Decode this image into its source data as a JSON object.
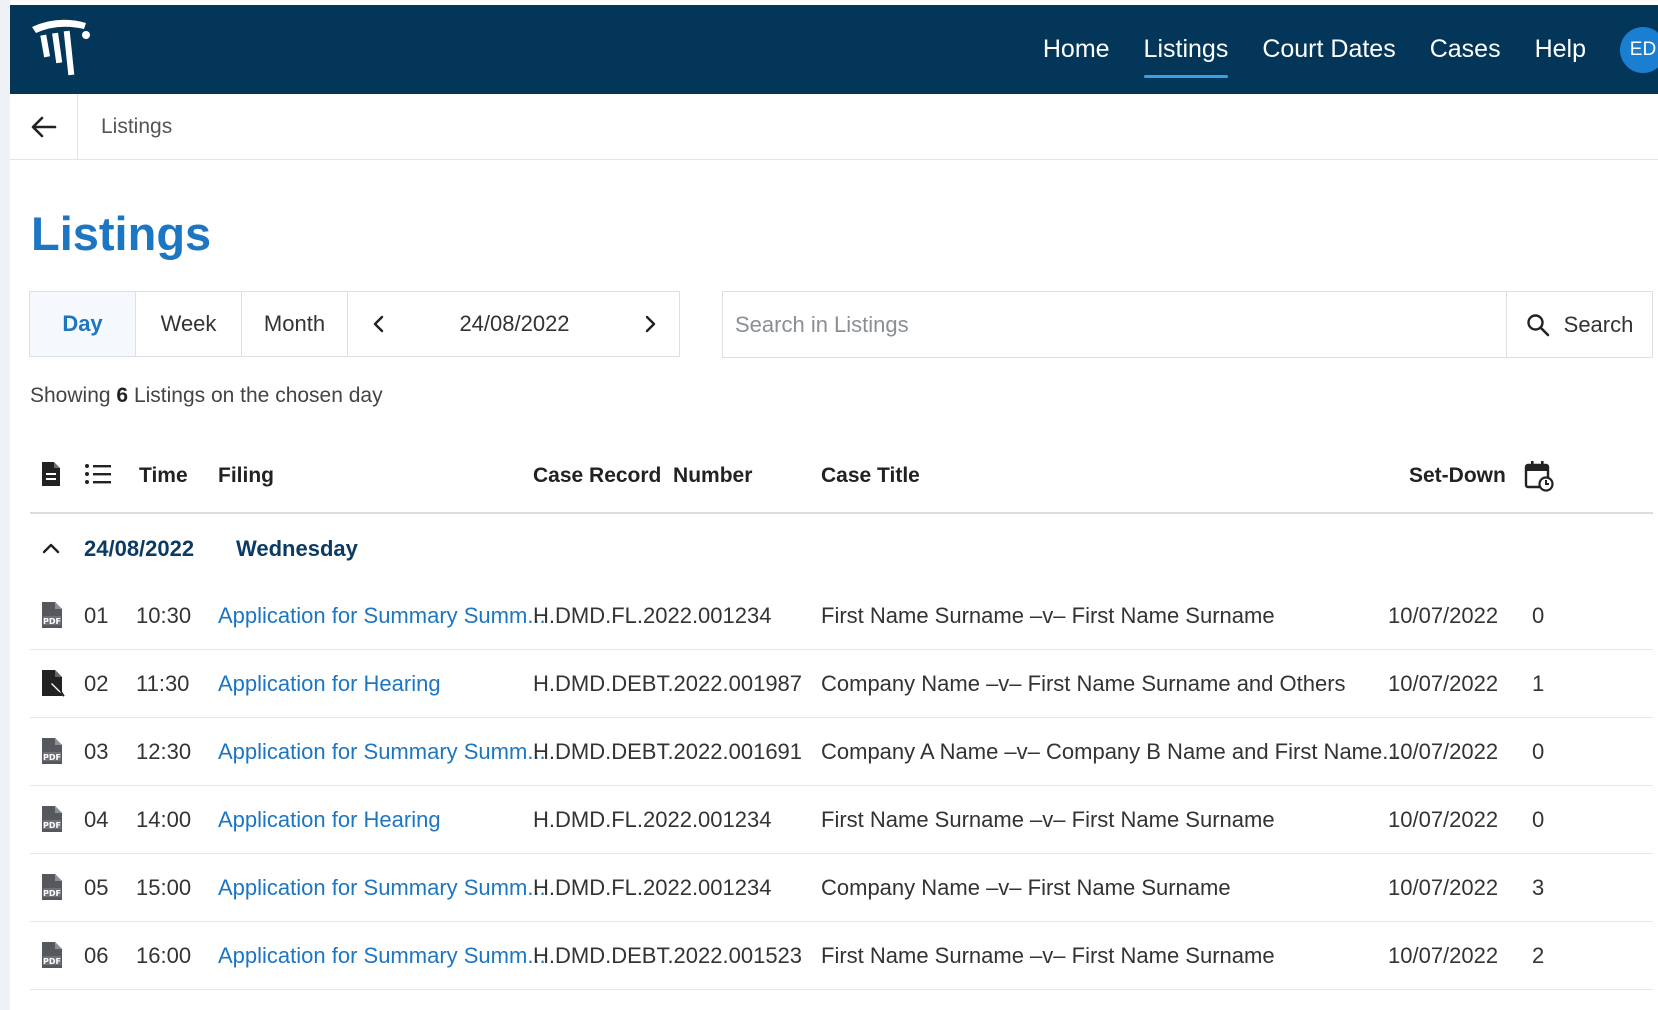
{
  "nav": {
    "items": [
      {
        "label": "Home",
        "active": false
      },
      {
        "label": "Listings",
        "active": true
      },
      {
        "label": "Court Dates",
        "active": false
      },
      {
        "label": "Cases",
        "active": false
      },
      {
        "label": "Help",
        "active": false
      }
    ],
    "avatar_initials": "ED"
  },
  "breadcrumb": {
    "current": "Listings"
  },
  "page": {
    "title": "Listings"
  },
  "filters": {
    "periods": [
      "Day",
      "Week",
      "Month"
    ],
    "active_period": "Day",
    "date": "24/08/2022"
  },
  "search": {
    "placeholder": "Search in Listings",
    "button_label": "Search"
  },
  "summary": {
    "prefix": "Showing",
    "count": "6",
    "suffix": "Listings on the chosen day"
  },
  "table": {
    "headers": {
      "time": "Time",
      "filing": "Filing",
      "case_record_number": "Case Record  Number",
      "case_title": "Case Title",
      "set_down": "Set-Down"
    },
    "group": {
      "date": "24/08/2022",
      "day": "Wednesday"
    },
    "rows": [
      {
        "icon": "pdf-file-icon",
        "num": "01",
        "time": "10:30",
        "filing": "Application for Summary Summ...",
        "case_number": "H.DMD.FL.2022.001234",
        "case_title": "First Name Surname –v– First Name Surname",
        "set_down": "10/07/2022",
        "count": "0"
      },
      {
        "icon": "file-sign-icon",
        "num": "02",
        "time": "11:30",
        "filing": "Application for Hearing",
        "case_number": "H.DMD.DEBT.2022.001987",
        "case_title": "Company Name –v– First Name Surname and Others",
        "set_down": "10/07/2022",
        "count": "1"
      },
      {
        "icon": "pdf-file-icon",
        "num": "03",
        "time": "12:30",
        "filing": "Application for Summary Summ...",
        "case_number": "H.DMD.DEBT.2022.001691",
        "case_title": "Company A Name –v– Company B Name and First Name...",
        "set_down": "10/07/2022",
        "count": "0"
      },
      {
        "icon": "pdf-file-icon",
        "num": "04",
        "time": "14:00",
        "filing": "Application for Hearing",
        "case_number": "H.DMD.FL.2022.001234",
        "case_title": "First Name Surname –v– First Name Surname",
        "set_down": "10/07/2022",
        "count": "0"
      },
      {
        "icon": "pdf-file-icon",
        "num": "05",
        "time": "15:00",
        "filing": "Application for Summary Summ...",
        "case_number": "H.DMD.FL.2022.001234",
        "case_title": "Company Name –v– First Name Surname",
        "set_down": "10/07/2022",
        "count": "3"
      },
      {
        "icon": "pdf-file-icon",
        "num": "06",
        "time": "16:00",
        "filing": "Application for Summary Summ...",
        "case_number": "H.DMD.DEBT.2022.001523",
        "case_title": "First Name Surname –v– First Name Surname",
        "set_down": "10/07/2022",
        "count": "2"
      }
    ]
  },
  "colors": {
    "nav_bg": "#04365a",
    "accent": "#1d76c2",
    "avatar_bg": "#1a7fd1"
  }
}
